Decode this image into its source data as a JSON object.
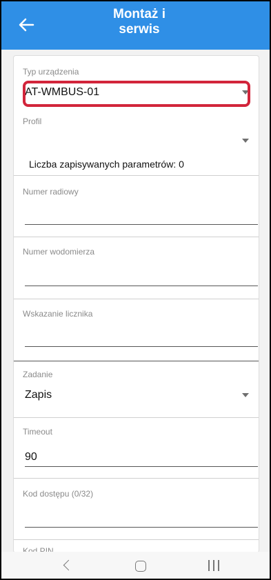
{
  "header": {
    "title_line1": "Montaż i",
    "title_line2": "serwis"
  },
  "form": {
    "device_type": {
      "label": "Typ urządzenia",
      "value": "AT-WMBUS-01"
    },
    "profile": {
      "label": "Profil",
      "value": ""
    },
    "saved_params": "Liczba zapisywanych parametrów: 0",
    "radio_number": {
      "label": "Numer radiowy",
      "value": ""
    },
    "meter_number": {
      "label": "Numer wodomierza",
      "value": ""
    },
    "counter_reading": {
      "label": "Wskazanie licznika",
      "value": ""
    },
    "task": {
      "label": "Zadanie",
      "value": "Zapis"
    },
    "timeout": {
      "label": "Timeout",
      "value": "90"
    },
    "access_code": {
      "label": "Kod dostępu (0/32)",
      "value": ""
    },
    "pin_code": {
      "label": "Kod PIN"
    }
  },
  "colors": {
    "appbar": "#2f8fe6",
    "highlight": "#d2253b"
  }
}
